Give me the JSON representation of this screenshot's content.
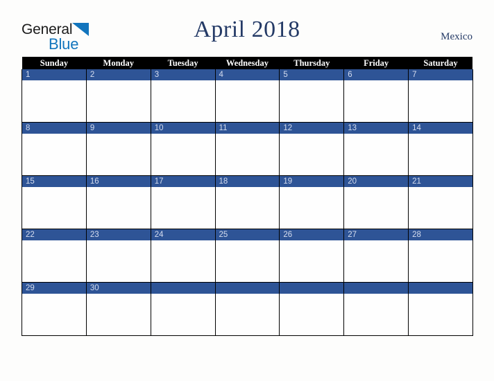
{
  "logo": {
    "text_primary": "General",
    "text_secondary": "Blue",
    "triangle_color": "#1275bd",
    "primary_color": "#1b1b1b"
  },
  "header": {
    "title": "April 2018",
    "country": "Mexico",
    "title_color": "#243a66"
  },
  "calendar": {
    "month": "April",
    "year": "2018",
    "header_background": "#000000",
    "header_text_color": "#ffffff",
    "date_band_color": "#2e5496",
    "date_text_color": "#d5ddef",
    "cell_background": "#fefefe",
    "grid_line_color": "#000000",
    "weekday_headers": [
      "Sunday",
      "Monday",
      "Tuesday",
      "Wednesday",
      "Thursday",
      "Friday",
      "Saturday"
    ],
    "weeks": [
      {
        "days": [
          {
            "number": "1"
          },
          {
            "number": "2"
          },
          {
            "number": "3"
          },
          {
            "number": "4"
          },
          {
            "number": "5"
          },
          {
            "number": "6"
          },
          {
            "number": "7"
          }
        ]
      },
      {
        "days": [
          {
            "number": "8"
          },
          {
            "number": "9"
          },
          {
            "number": "10"
          },
          {
            "number": "11"
          },
          {
            "number": "12"
          },
          {
            "number": "13"
          },
          {
            "number": "14"
          }
        ]
      },
      {
        "days": [
          {
            "number": "15"
          },
          {
            "number": "16"
          },
          {
            "number": "17"
          },
          {
            "number": "18"
          },
          {
            "number": "19"
          },
          {
            "number": "20"
          },
          {
            "number": "21"
          }
        ]
      },
      {
        "days": [
          {
            "number": "22"
          },
          {
            "number": "23"
          },
          {
            "number": "24"
          },
          {
            "number": "25"
          },
          {
            "number": "26"
          },
          {
            "number": "27"
          },
          {
            "number": "28"
          }
        ]
      },
      {
        "days": [
          {
            "number": "29"
          },
          {
            "number": "30"
          },
          {
            "number": ""
          },
          {
            "number": ""
          },
          {
            "number": ""
          },
          {
            "number": ""
          },
          {
            "number": ""
          }
        ]
      }
    ]
  }
}
